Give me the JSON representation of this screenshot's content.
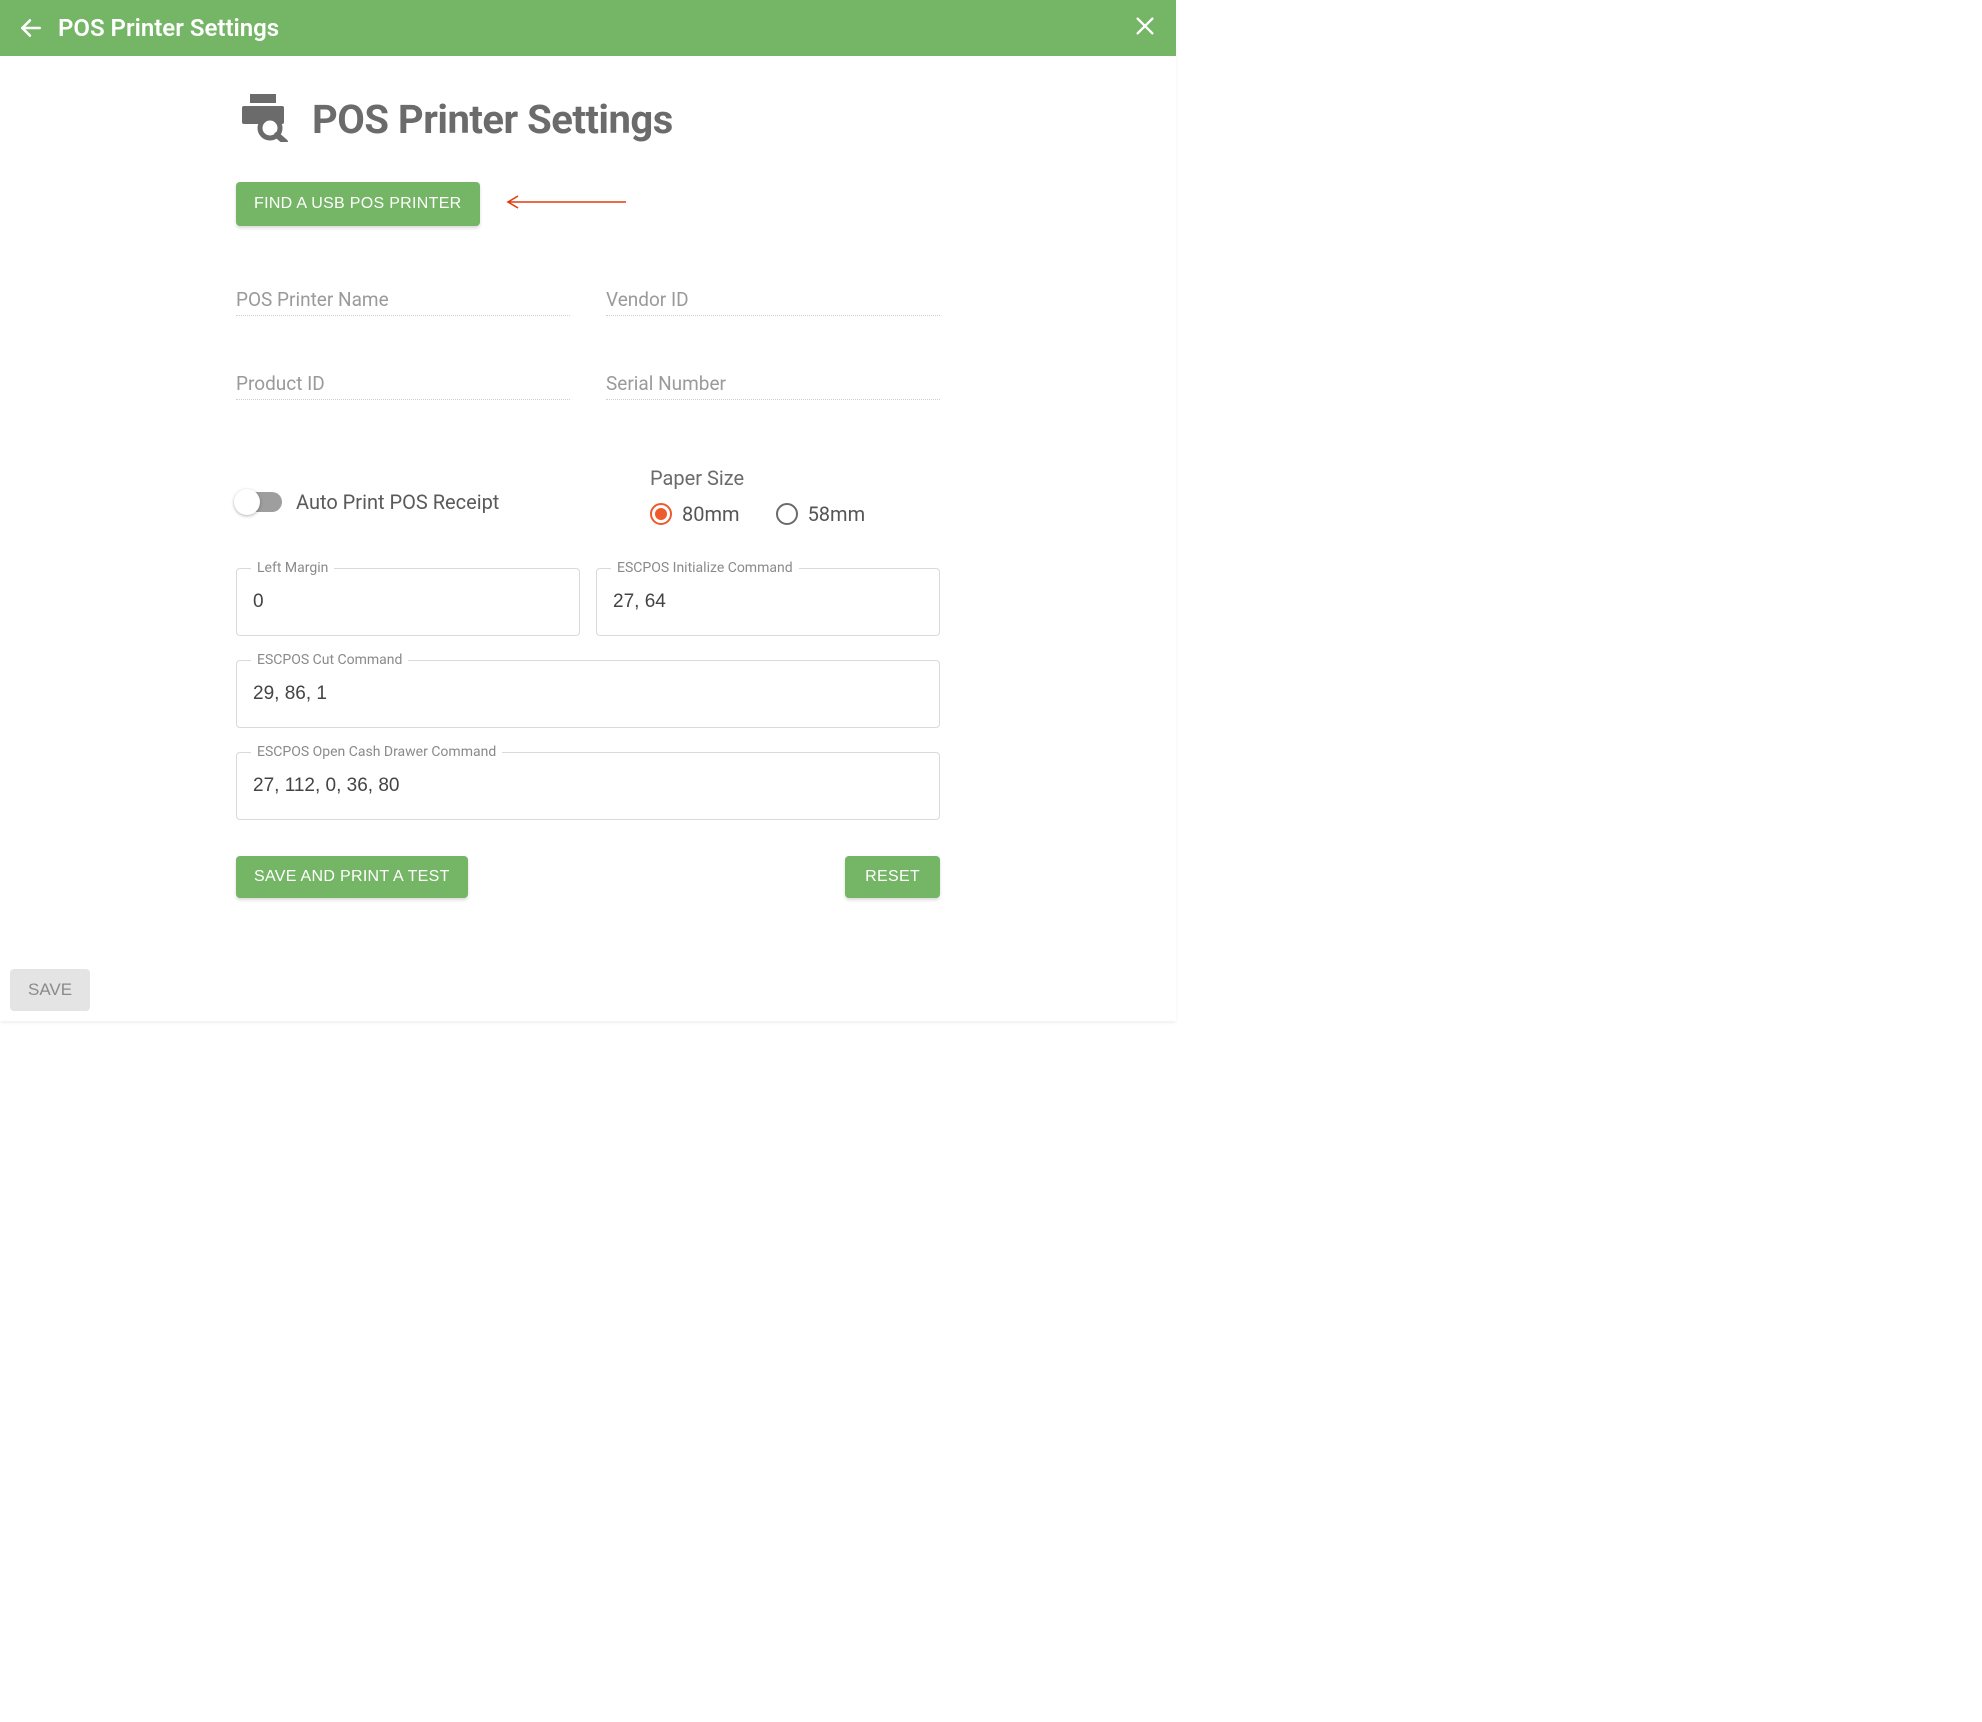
{
  "header": {
    "title": "POS Printer Settings"
  },
  "page": {
    "heading": "POS Printer Settings"
  },
  "buttons": {
    "find_usb": "FIND A USB POS PRINTER",
    "save_test": "SAVE AND PRINT A TEST",
    "reset": "RESET",
    "bottom_save": "SAVE"
  },
  "ro_fields": {
    "printer_name": {
      "label": "POS Printer Name",
      "value": ""
    },
    "vendor_id": {
      "label": "Vendor ID",
      "value": ""
    },
    "product_id": {
      "label": "Product ID",
      "value": ""
    },
    "serial_number": {
      "label": "Serial Number",
      "value": ""
    }
  },
  "toggle": {
    "auto_print_label": "Auto Print POS Receipt",
    "auto_print_on": false
  },
  "paper_size": {
    "label": "Paper Size",
    "options": [
      "80mm",
      "58mm"
    ],
    "selected": "80mm"
  },
  "fields": {
    "left_margin": {
      "label": "Left Margin",
      "value": "0"
    },
    "escpos_init": {
      "label": "ESCPOS Initialize Command",
      "value": "27, 64"
    },
    "escpos_cut": {
      "label": "ESCPOS Cut Command",
      "value": "29, 86, 1"
    },
    "escpos_drawer": {
      "label": "ESCPOS Open Cash Drawer Command",
      "value": "27, 112, 0, 36, 80"
    }
  },
  "colors": {
    "brand_green": "#74b566",
    "accent_orange": "#ed5b2d"
  }
}
